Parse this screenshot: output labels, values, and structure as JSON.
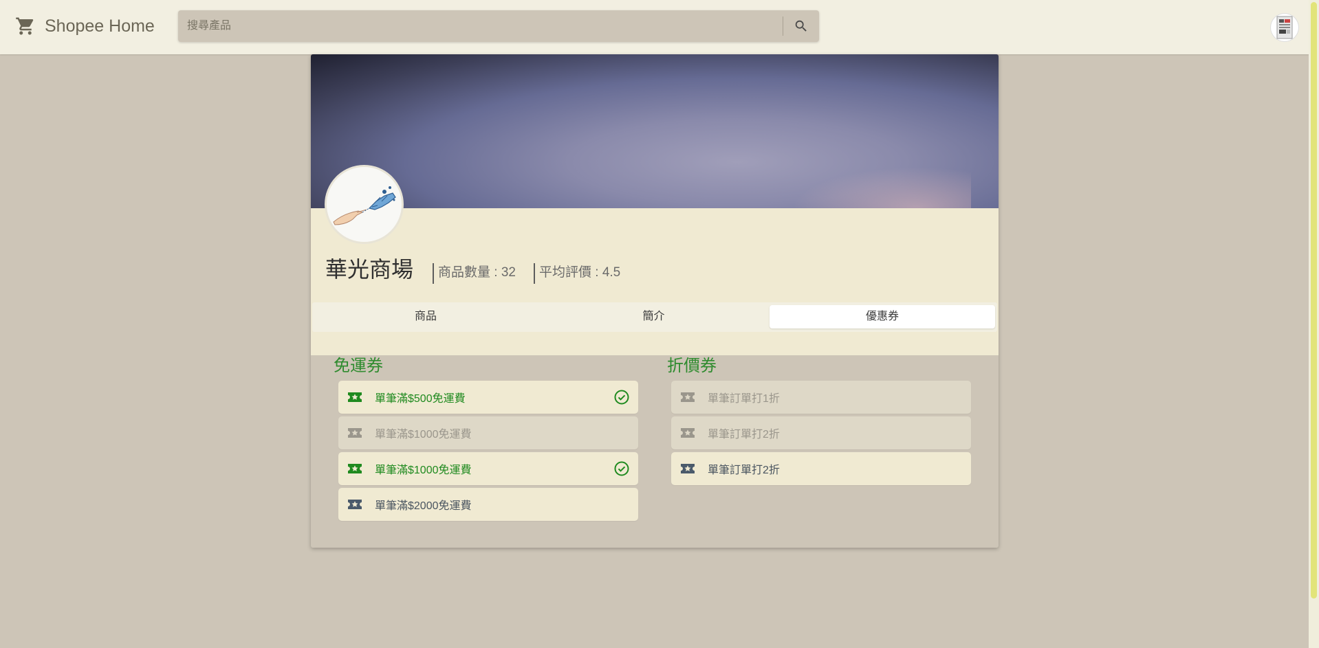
{
  "header": {
    "brand": "Shopee Home",
    "search_placeholder": "搜尋產品"
  },
  "shop": {
    "name": "華光商場",
    "product_count": "商品數量 : 32",
    "avg_rating": "平均評價 : 4.5"
  },
  "tabs": [
    {
      "label": "商品",
      "active": false
    },
    {
      "label": "簡介",
      "active": false
    },
    {
      "label": "優惠券",
      "active": true
    }
  ],
  "free_shipping": {
    "title": "免運券",
    "coupons": [
      {
        "label": "單筆滿$500免運費",
        "state": "selected"
      },
      {
        "label": "單筆滿$1000免運費",
        "state": "disabled"
      },
      {
        "label": "單筆滿$1000免運費",
        "state": "selected"
      },
      {
        "label": "單筆滿$2000免運費",
        "state": "available"
      }
    ]
  },
  "discount": {
    "title": "折價券",
    "coupons": [
      {
        "label": "單筆訂單打1折",
        "state": "disabled"
      },
      {
        "label": "單筆訂單打2折",
        "state": "disabled"
      },
      {
        "label": "單筆訂單打2折",
        "state": "available"
      }
    ]
  },
  "colors": {
    "accent_green": "#1f8a1f",
    "topbar": "#f2efe1",
    "page_bg": "#cdc5b7",
    "card_panel": "#f0ead2"
  },
  "icons": [
    "cart-icon",
    "search-icon",
    "ticket-icon",
    "check-circle-icon"
  ]
}
